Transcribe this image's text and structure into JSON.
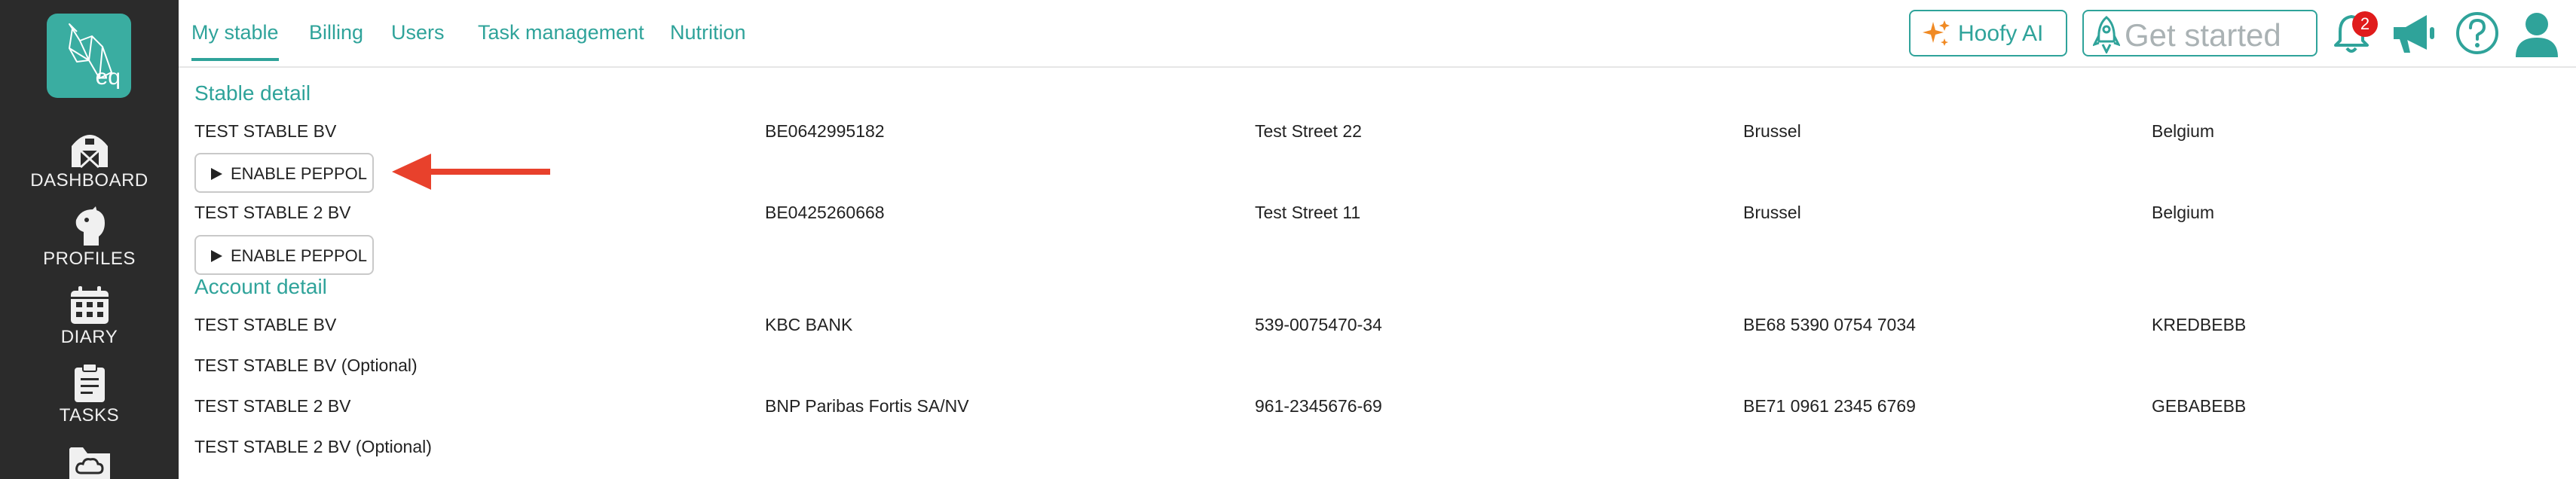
{
  "sidebar": {
    "logo_text": "eq",
    "items": [
      {
        "label": "DASHBOARD"
      },
      {
        "label": "PROFILES"
      },
      {
        "label": "DIARY"
      },
      {
        "label": "TASKS"
      }
    ]
  },
  "tabs": [
    {
      "label": "My stable"
    },
    {
      "label": "Billing"
    },
    {
      "label": "Users"
    },
    {
      "label": "Task management"
    },
    {
      "label": "Nutrition"
    }
  ],
  "topbar": {
    "hoofy_label": "Hoofy AI",
    "get_started_label": "Get started",
    "notification_count": "2"
  },
  "stable_detail": {
    "title": "Stable detail",
    "rows": [
      {
        "name": "TEST STABLE BV",
        "vat": "BE0642995182",
        "street": "Test Street 22",
        "city": "Brussel",
        "country": "Belgium",
        "button_label": "ENABLE PEPPOL"
      },
      {
        "name": "TEST STABLE 2 BV",
        "vat": "BE0425260668",
        "street": "Test Street 11",
        "city": "Brussel",
        "country": "Belgium",
        "button_label": "ENABLE PEPPOL"
      }
    ]
  },
  "account_detail": {
    "title": "Account detail",
    "rows": [
      {
        "name": "TEST STABLE BV",
        "bank": "KBC BANK",
        "account": "539-0075470-34",
        "iban": "BE68 5390 0754 7034",
        "bic": "KREDBEBB",
        "optional": "TEST STABLE BV (Optional)"
      },
      {
        "name": "TEST STABLE 2 BV",
        "bank": "BNP Paribas Fortis SA/NV",
        "account": "961-2345676-69",
        "iban": "BE71 0961 2345 6769",
        "bic": "GEBABEBB",
        "optional": "TEST STABLE 2 BV (Optional)"
      }
    ]
  },
  "colors": {
    "accent": "#2fa39a",
    "sidebar": "#2b2b2b",
    "arrow": "#e8412c",
    "badge": "#e01c1c"
  },
  "icons": [
    "horse-logo-icon",
    "barn-icon",
    "horse-head-icon",
    "calendar-icon",
    "clipboard-icon",
    "folder-cloud-icon",
    "sparkle-icon",
    "rocket-icon",
    "bell-icon",
    "megaphone-icon",
    "help-icon",
    "user-icon",
    "arrow-icon"
  ]
}
